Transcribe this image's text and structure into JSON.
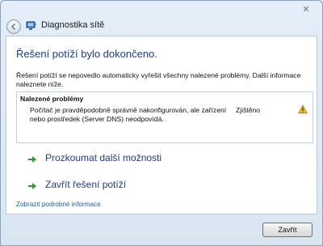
{
  "window": {
    "title": "Diagnostika sítě",
    "close_glyph": "✕"
  },
  "content": {
    "heading": "Řešení potíží bylo dokončeno.",
    "description": "Řešení potíží se nepovedlo automaticky vyřešit všechny nalezené problémy. Další informace naleznete níže.",
    "problems": {
      "header": "Nalezené problémy",
      "items": [
        {
          "text": "Počítač je pravděpodobně správně nakonfigurován, ale zařízení nebo prostředek (Server DNS) neodpovídá.",
          "status": "Zjištěno",
          "icon": "warning-icon"
        }
      ]
    },
    "actions": {
      "explore": "Prozkoumat další možnosti",
      "close_troubleshooting": "Zavřít řešení potíží"
    },
    "details_link": "Zobrazit podrobné informace"
  },
  "footer": {
    "close_button": "Zavřít"
  },
  "colors": {
    "heading": "#1e3c8c",
    "link": "#1a5fb4",
    "arrow": "#2f9a2f",
    "warning": "#f2c21b"
  }
}
